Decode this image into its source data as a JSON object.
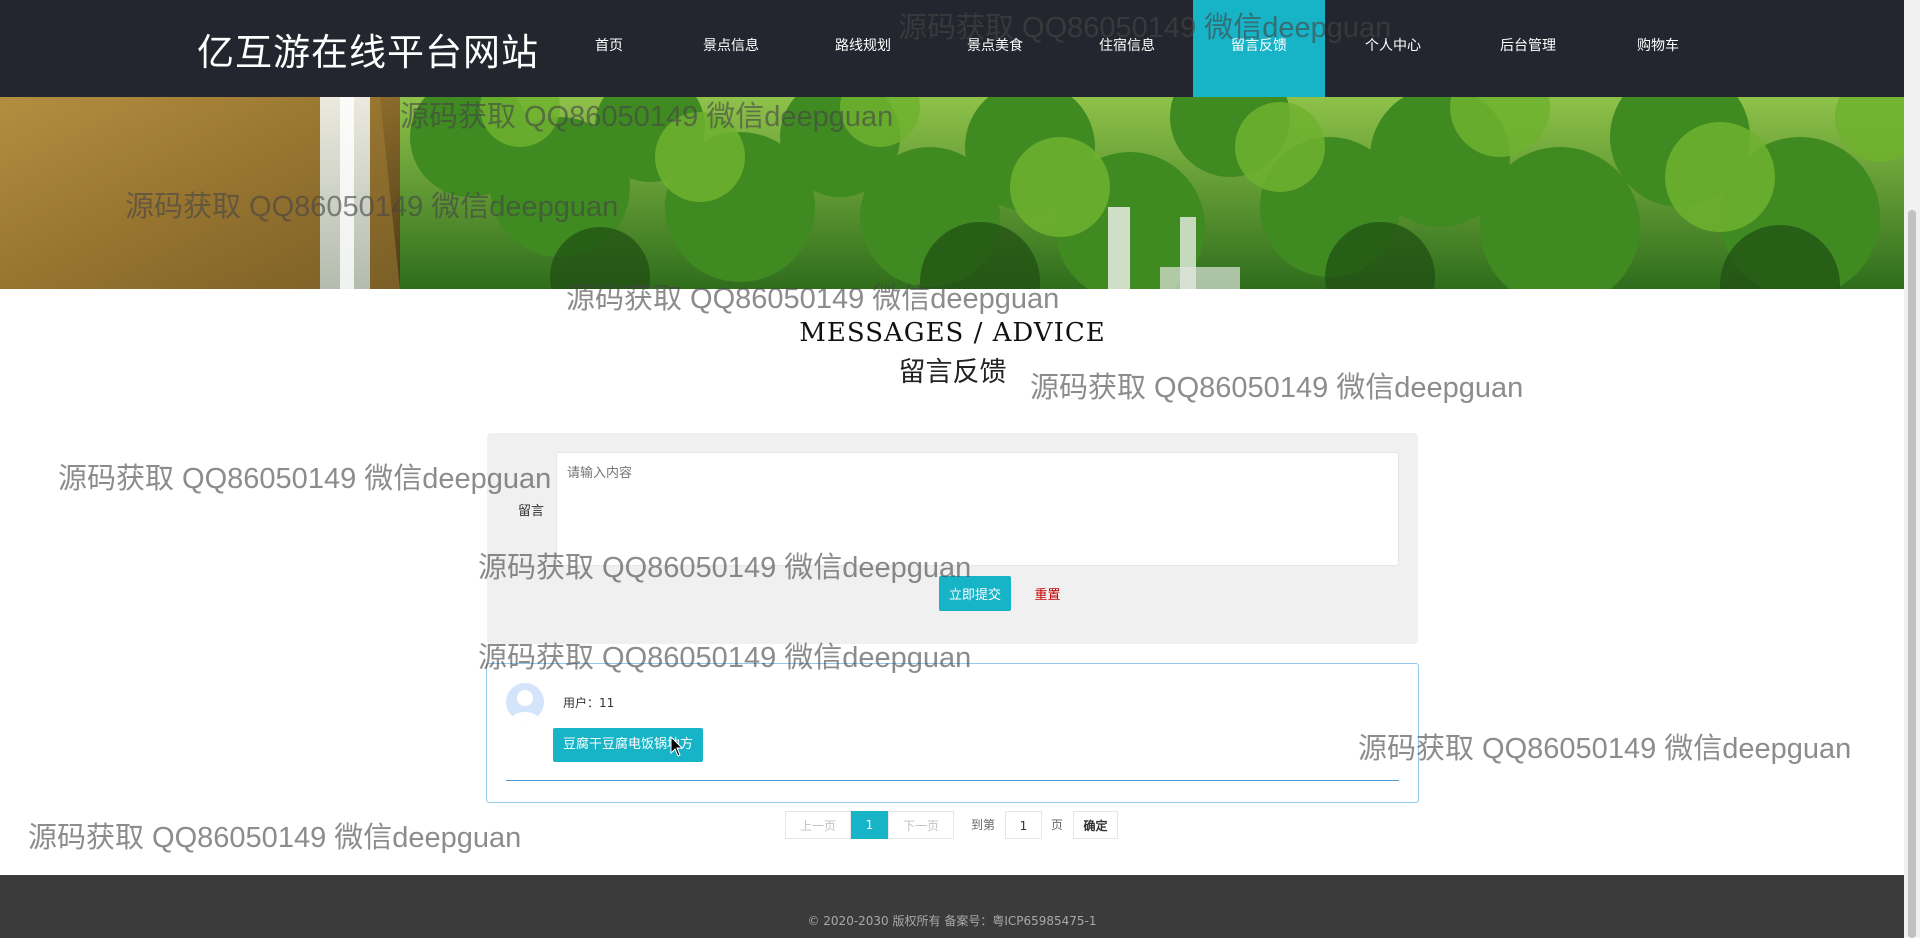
{
  "site": {
    "brand": "亿互游在线平台网站"
  },
  "nav": {
    "items": [
      {
        "label": "首页"
      },
      {
        "label": "景点信息"
      },
      {
        "label": "路线规划"
      },
      {
        "label": "景点美食"
      },
      {
        "label": "住宿信息"
      },
      {
        "label": "留言反馈",
        "active": true
      },
      {
        "label": "个人中心"
      },
      {
        "label": "后台管理"
      },
      {
        "label": "购物车"
      }
    ]
  },
  "section": {
    "title": "MESSAGES / ADVICE",
    "subtitle": "留言反馈"
  },
  "form": {
    "label": "留言",
    "placeholder": "请输入内容",
    "submit_label": "立即提交",
    "reset_label": "重置"
  },
  "messages": [
    {
      "user": "用户：11",
      "content": "豆腐干豆腐电饭锅地方"
    }
  ],
  "pagination": {
    "prev": "上一页",
    "current": "1",
    "next": "下一页",
    "goto_prefix": "到第",
    "goto_value": "1",
    "goto_suffix": "页",
    "confirm": "确定"
  },
  "footer": {
    "text": "© 2020-2030 版权所有 备案号：粤ICP65985475-1"
  },
  "watermark": {
    "text": "源码获取 QQ86050149 微信deepguan"
  },
  "colors": {
    "accent": "#17b3c7",
    "nav_bg": "#23262e",
    "footer_bg": "#3b3b3b",
    "reset": "#c80000"
  }
}
